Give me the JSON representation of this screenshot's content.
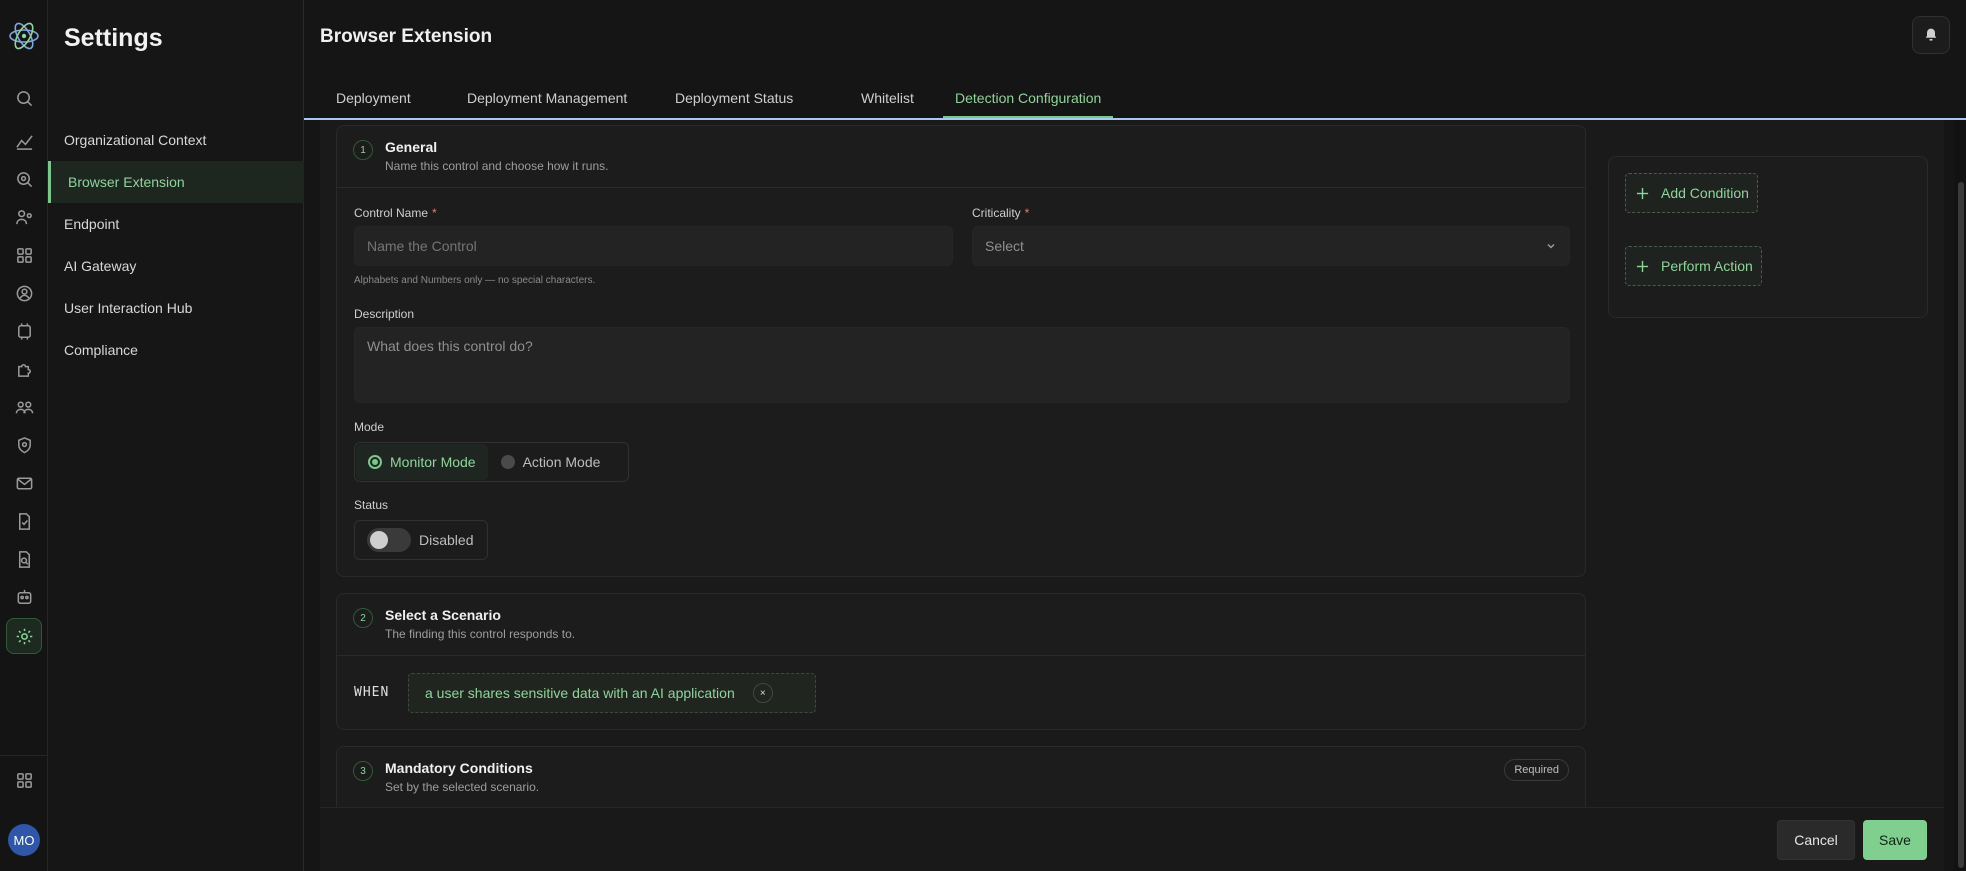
{
  "rail": {
    "avatar_initials": "MO",
    "icons": [
      "logo-icon",
      "search-icon",
      "analytics-icon",
      "ai-scan-icon",
      "users-graph-icon",
      "apps-grid-icon",
      "user-circle-icon",
      "ai-chip-icon",
      "puzzle-icon",
      "team-icon",
      "shield-search-icon",
      "mail-icon",
      "document-check-icon",
      "file-search-icon",
      "robot-icon",
      "gear-icon",
      "grid-apps-icon"
    ]
  },
  "sidebar": {
    "title": "Settings",
    "items": [
      {
        "label": "Organizational Context"
      },
      {
        "label": "Browser Extension"
      },
      {
        "label": "Endpoint"
      },
      {
        "label": "AI Gateway"
      },
      {
        "label": "User Interaction Hub"
      },
      {
        "label": "Compliance"
      }
    ]
  },
  "header": {
    "title": "Browser Extension",
    "tabs": [
      {
        "label": "Deployment"
      },
      {
        "label": "Deployment Management"
      },
      {
        "label": "Deployment Status"
      },
      {
        "label": "Whitelist"
      },
      {
        "label": "Detection Configuration"
      }
    ],
    "active_tab": "Detection Configuration"
  },
  "general": {
    "step": "1",
    "title": "General",
    "subtitle": "Name this control and choose how it runs.",
    "control_name_label": "Control Name",
    "control_name_placeholder": "Name the Control",
    "control_name_hint": "Alphabets and Numbers only — no special characters.",
    "criticality_label": "Criticality",
    "criticality_value": "Select",
    "required_mark": "*",
    "description_label": "Description",
    "description_placeholder": "What does this control do?",
    "mode_label": "Mode",
    "mode_options": [
      {
        "label": "Monitor Mode",
        "selected": true
      },
      {
        "label": "Action Mode",
        "selected": false
      }
    ],
    "status_label": "Status",
    "status_value": "Disabled"
  },
  "scenario": {
    "step": "2",
    "title": "Select a Scenario",
    "subtitle": "The finding this control responds to.",
    "when_label": "WHEN",
    "chip_text": "a user shares sensitive data with an AI application",
    "chip_remove": "×"
  },
  "mandatory": {
    "step": "3",
    "title": "Mandatory Conditions",
    "subtitle": "Set by the selected scenario.",
    "badge": "Required"
  },
  "side_panel": {
    "add_condition": "Add Condition",
    "perform_action": "Perform Action"
  },
  "footer": {
    "cancel_label": "Cancel",
    "save_label": "Save"
  },
  "colors": {
    "accent": "#79c98a",
    "accent_text": "#8fd49b",
    "background": "#151515",
    "card": "#1c1c1c",
    "avatar": "#2f56a8",
    "tab_underline": "#a9c7ef"
  }
}
